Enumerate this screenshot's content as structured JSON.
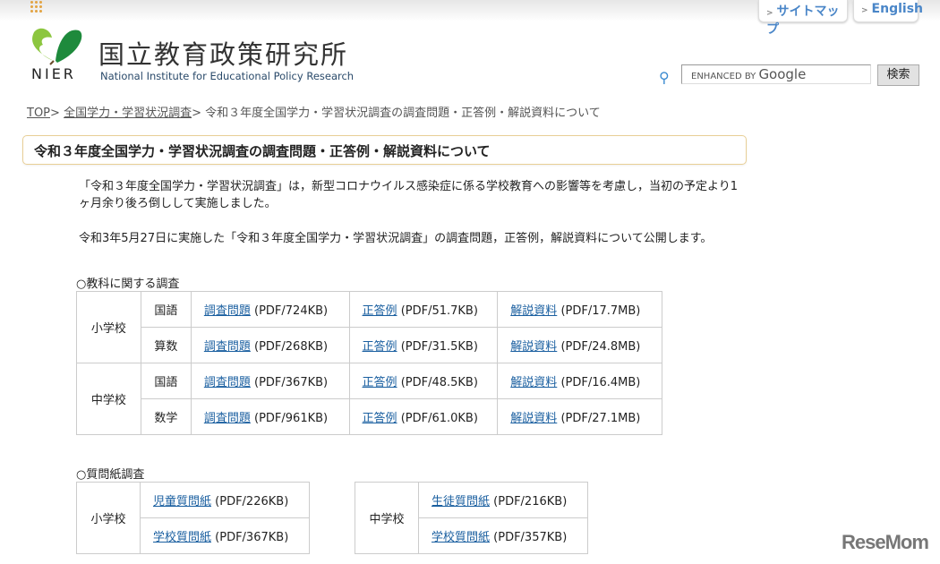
{
  "header": {
    "sitemap": "サイトマップ",
    "english": "English",
    "logo_abbr": "NIER",
    "org_name_jp": "国立教育政策研究所",
    "org_name_en": "National Institute for Educational Policy Research",
    "search_placeholder_prefix": "ENHANCED BY",
    "search_placeholder_brand": "Google",
    "search_button": "検索"
  },
  "breadcrumb": {
    "top": "TOP",
    "sep": ">",
    "parent": "全国学力・学習状況調査",
    "current": "令和３年度全国学力・学習状況調査の調査問題・正答例・解説資料について"
  },
  "page_title": "令和３年度全国学力・学習状況調査の調査問題・正答例・解説資料について",
  "intro": [
    "「令和３年度全国学力・学習状況調査」は，新型コロナウイルス感染症に係る学校教育への影響等を考慮し，当初の予定より1ヶ月余り後ろ倒しして実施しました。",
    "令和3年5月27日に実施した「令和３年度全国学力・学習状況調査」の調査問題，正答例，解説資料について公開します。"
  ],
  "subjects_section": {
    "heading": "○教科に関する調査",
    "schools": [
      {
        "name": "小学校",
        "rows": [
          {
            "subject": "国語",
            "q": "調査問題",
            "q_size": "(PDF/724KB)",
            "a": "正答例",
            "a_size": "(PDF/51.7KB)",
            "e": "解説資料",
            "e_size": "(PDF/17.7MB)"
          },
          {
            "subject": "算数",
            "q": "調査問題",
            "q_size": "(PDF/268KB)",
            "a": "正答例",
            "a_size": "(PDF/31.5KB)",
            "e": "解説資料",
            "e_size": "(PDF/24.8MB)"
          }
        ]
      },
      {
        "name": "中学校",
        "rows": [
          {
            "subject": "国語",
            "q": "調査問題",
            "q_size": "(PDF/367KB)",
            "a": "正答例",
            "a_size": "(PDF/48.5KB)",
            "e": "解説資料",
            "e_size": "(PDF/16.4MB)"
          },
          {
            "subject": "数学",
            "q": "調査問題",
            "q_size": "(PDF/961KB)",
            "a": "正答例",
            "a_size": "(PDF/61.0KB)",
            "e": "解説資料",
            "e_size": "(PDF/27.1MB)"
          }
        ]
      }
    ]
  },
  "questionnaire_section": {
    "heading": "○質問紙調査",
    "elementary": {
      "name": "小学校",
      "items": [
        {
          "link": "児童質問紙",
          "size": "(PDF/226KB)"
        },
        {
          "link": "学校質問紙",
          "size": "(PDF/367KB)"
        }
      ]
    },
    "junior": {
      "name": "中学校",
      "items": [
        {
          "link": "生徒質問紙",
          "size": "(PDF/216KB)"
        },
        {
          "link": "学校質問紙",
          "size": "(PDF/357KB)"
        }
      ]
    }
  },
  "watermark": "ReseMom"
}
